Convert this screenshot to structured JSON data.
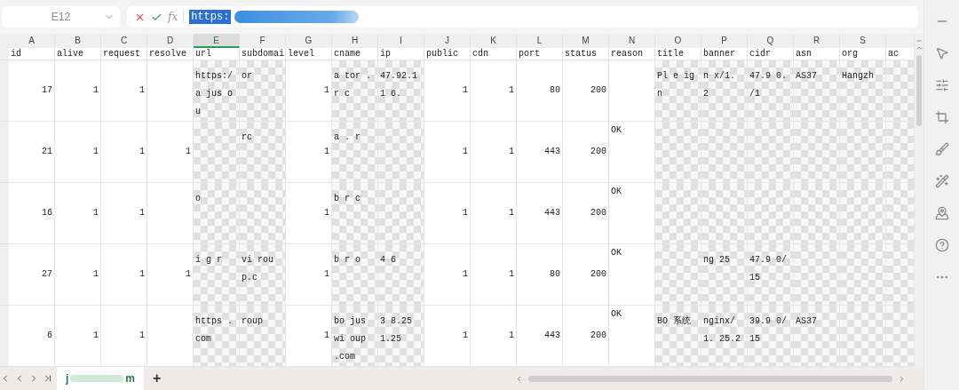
{
  "name_box": {
    "value": "E12"
  },
  "formula_bar": {
    "fx": "fx",
    "value": "https:",
    "selected": true,
    "redacted": true
  },
  "columns": [
    {
      "letter": "A",
      "header": "id",
      "kind": "number",
      "selected": false
    },
    {
      "letter": "B",
      "header": "alive",
      "kind": "number",
      "selected": false
    },
    {
      "letter": "C",
      "header": "request",
      "kind": "number",
      "selected": false
    },
    {
      "letter": "D",
      "header": "resolve",
      "kind": "number",
      "selected": false
    },
    {
      "letter": "E",
      "header": "url",
      "kind": "text",
      "selected": true
    },
    {
      "letter": "F",
      "header": "subdomai",
      "kind": "text",
      "selected": false
    },
    {
      "letter": "G",
      "header": "level",
      "kind": "number",
      "selected": false
    },
    {
      "letter": "H",
      "header": "cname",
      "kind": "text",
      "selected": false
    },
    {
      "letter": "I",
      "header": "ip",
      "kind": "text",
      "selected": false
    },
    {
      "letter": "J",
      "header": "public",
      "kind": "number",
      "selected": false
    },
    {
      "letter": "K",
      "header": "cdn",
      "kind": "number",
      "selected": false
    },
    {
      "letter": "L",
      "header": "port",
      "kind": "number",
      "selected": false
    },
    {
      "letter": "M",
      "header": "status",
      "kind": "number",
      "selected": false
    },
    {
      "letter": "N",
      "header": "reason",
      "kind": "text",
      "selected": false
    },
    {
      "letter": "O",
      "header": "title",
      "kind": "text",
      "selected": false
    },
    {
      "letter": "P",
      "header": "banner",
      "kind": "text",
      "selected": false
    },
    {
      "letter": "Q",
      "header": "cidr",
      "kind": "text",
      "selected": false
    },
    {
      "letter": "R",
      "header": "asn",
      "kind": "text",
      "selected": false
    },
    {
      "letter": "S",
      "header": "org",
      "kind": "text",
      "selected": false
    },
    {
      "header": "ac",
      "kind": "text",
      "selected": false
    }
  ],
  "rows": [
    {
      "cells": [
        {
          "text": "17",
          "redacted": false
        },
        {
          "text": "1",
          "redacted": false
        },
        {
          "text": "1",
          "redacted": false
        },
        {
          "redacted": false
        },
        {
          "text": "https:/a jus ou",
          "redacted": true
        },
        {
          "text": "or",
          "redacted": true
        },
        {
          "text": "1",
          "redacted": false
        },
        {
          "text": "a tor . r c",
          "redacted": true
        },
        {
          "text": "47.92.11 6.",
          "redacted": true
        },
        {
          "text": "1",
          "redacted": false
        },
        {
          "text": "1",
          "redacted": false
        },
        {
          "text": "80",
          "redacted": false
        },
        {
          "text": "200",
          "redacted": false
        },
        {
          "redacted": false
        },
        {
          "text": "Pl e ig n",
          "redacted": true
        },
        {
          "text": "n x/1. 2",
          "redacted": true
        },
        {
          "text": "47.9 0. /1",
          "redacted": true
        },
        {
          "text": "AS37",
          "redacted": true
        },
        {
          "text": "Hangzh",
          "redacted": true
        },
        {
          "redacted": true
        }
      ]
    },
    {
      "cells": [
        {
          "text": "21",
          "redacted": false
        },
        {
          "text": "1",
          "redacted": false
        },
        {
          "text": "1",
          "redacted": false
        },
        {
          "text": "1",
          "redacted": false
        },
        {
          "redacted": true
        },
        {
          "text": "rc",
          "redacted": true
        },
        {
          "text": "1",
          "redacted": false
        },
        {
          "text": "a . r",
          "redacted": true
        },
        {
          "redacted": true
        },
        {
          "text": "1",
          "redacted": false
        },
        {
          "text": "1",
          "redacted": false
        },
        {
          "text": "443",
          "redacted": false
        },
        {
          "text": "200",
          "redacted": false
        },
        {
          "text": "OK",
          "redacted": false
        },
        {
          "redacted": true
        },
        {
          "redacted": true
        },
        {
          "redacted": true
        },
        {
          "redacted": true
        },
        {
          "redacted": true
        },
        {
          "redacted": true
        }
      ]
    },
    {
      "cells": [
        {
          "text": "16",
          "redacted": false
        },
        {
          "text": "1",
          "redacted": false
        },
        {
          "text": "1",
          "redacted": false
        },
        {
          "redacted": false
        },
        {
          "text": "o",
          "redacted": true
        },
        {
          "redacted": true
        },
        {
          "text": "1",
          "redacted": false
        },
        {
          "text": "b r c",
          "redacted": true
        },
        {
          "redacted": true
        },
        {
          "text": "1",
          "redacted": false
        },
        {
          "text": "1",
          "redacted": false
        },
        {
          "text": "443",
          "redacted": false
        },
        {
          "text": "200",
          "redacted": false
        },
        {
          "text": "OK",
          "redacted": false
        },
        {
          "redacted": true
        },
        {
          "redacted": true
        },
        {
          "redacted": true
        },
        {
          "redacted": true
        },
        {
          "redacted": true
        },
        {
          "redacted": true
        }
      ]
    },
    {
      "cells": [
        {
          "text": "27",
          "redacted": false
        },
        {
          "text": "1",
          "redacted": false
        },
        {
          "text": "1",
          "redacted": false
        },
        {
          "text": "1",
          "redacted": false
        },
        {
          "text": "i g r",
          "redacted": true
        },
        {
          "text": "vi roup.c",
          "redacted": true
        },
        {
          "text": "1",
          "redacted": false
        },
        {
          "text": "b r o",
          "redacted": true
        },
        {
          "text": "4 6",
          "redacted": true
        },
        {
          "text": "1",
          "redacted": false
        },
        {
          "text": "1",
          "redacted": false
        },
        {
          "text": "80",
          "redacted": false
        },
        {
          "text": "200",
          "redacted": false
        },
        {
          "text": "OK",
          "redacted": false
        },
        {
          "redacted": true
        },
        {
          "text": "ng 25",
          "redacted": true
        },
        {
          "text": "47.9 0/15",
          "redacted": true
        },
        {
          "redacted": true
        },
        {
          "redacted": true
        },
        {
          "redacted": true
        }
      ]
    },
    {
      "cells": [
        {
          "text": "6",
          "redacted": false
        },
        {
          "text": "1",
          "redacted": false
        },
        {
          "text": "1",
          "redacted": false
        },
        {
          "redacted": false
        },
        {
          "text": "https .com",
          "redacted": true
        },
        {
          "text": "roup",
          "redacted": true
        },
        {
          "text": "1",
          "redacted": false
        },
        {
          "text": "bo jus wi oup .com",
          "redacted": true
        },
        {
          "text": "3 8.25 1.25",
          "redacted": true
        },
        {
          "text": "1",
          "redacted": false
        },
        {
          "text": "1",
          "redacted": false
        },
        {
          "text": "443",
          "redacted": false
        },
        {
          "text": "200",
          "redacted": false
        },
        {
          "text": "OK",
          "redacted": false
        },
        {
          "text": "BO 系统",
          "redacted": true
        },
        {
          "text": "nginx/1. 25.2",
          "redacted": true
        },
        {
          "text": "39.9 0/15",
          "redacted": true
        },
        {
          "text": "AS37",
          "redacted": true
        },
        {
          "redacted": true
        },
        {
          "redacted": true
        }
      ]
    }
  ],
  "sheet_tabs": [
    {
      "label_start": "j",
      "label_end": "m",
      "selected": true
    }
  ],
  "add_sheet": "+"
}
